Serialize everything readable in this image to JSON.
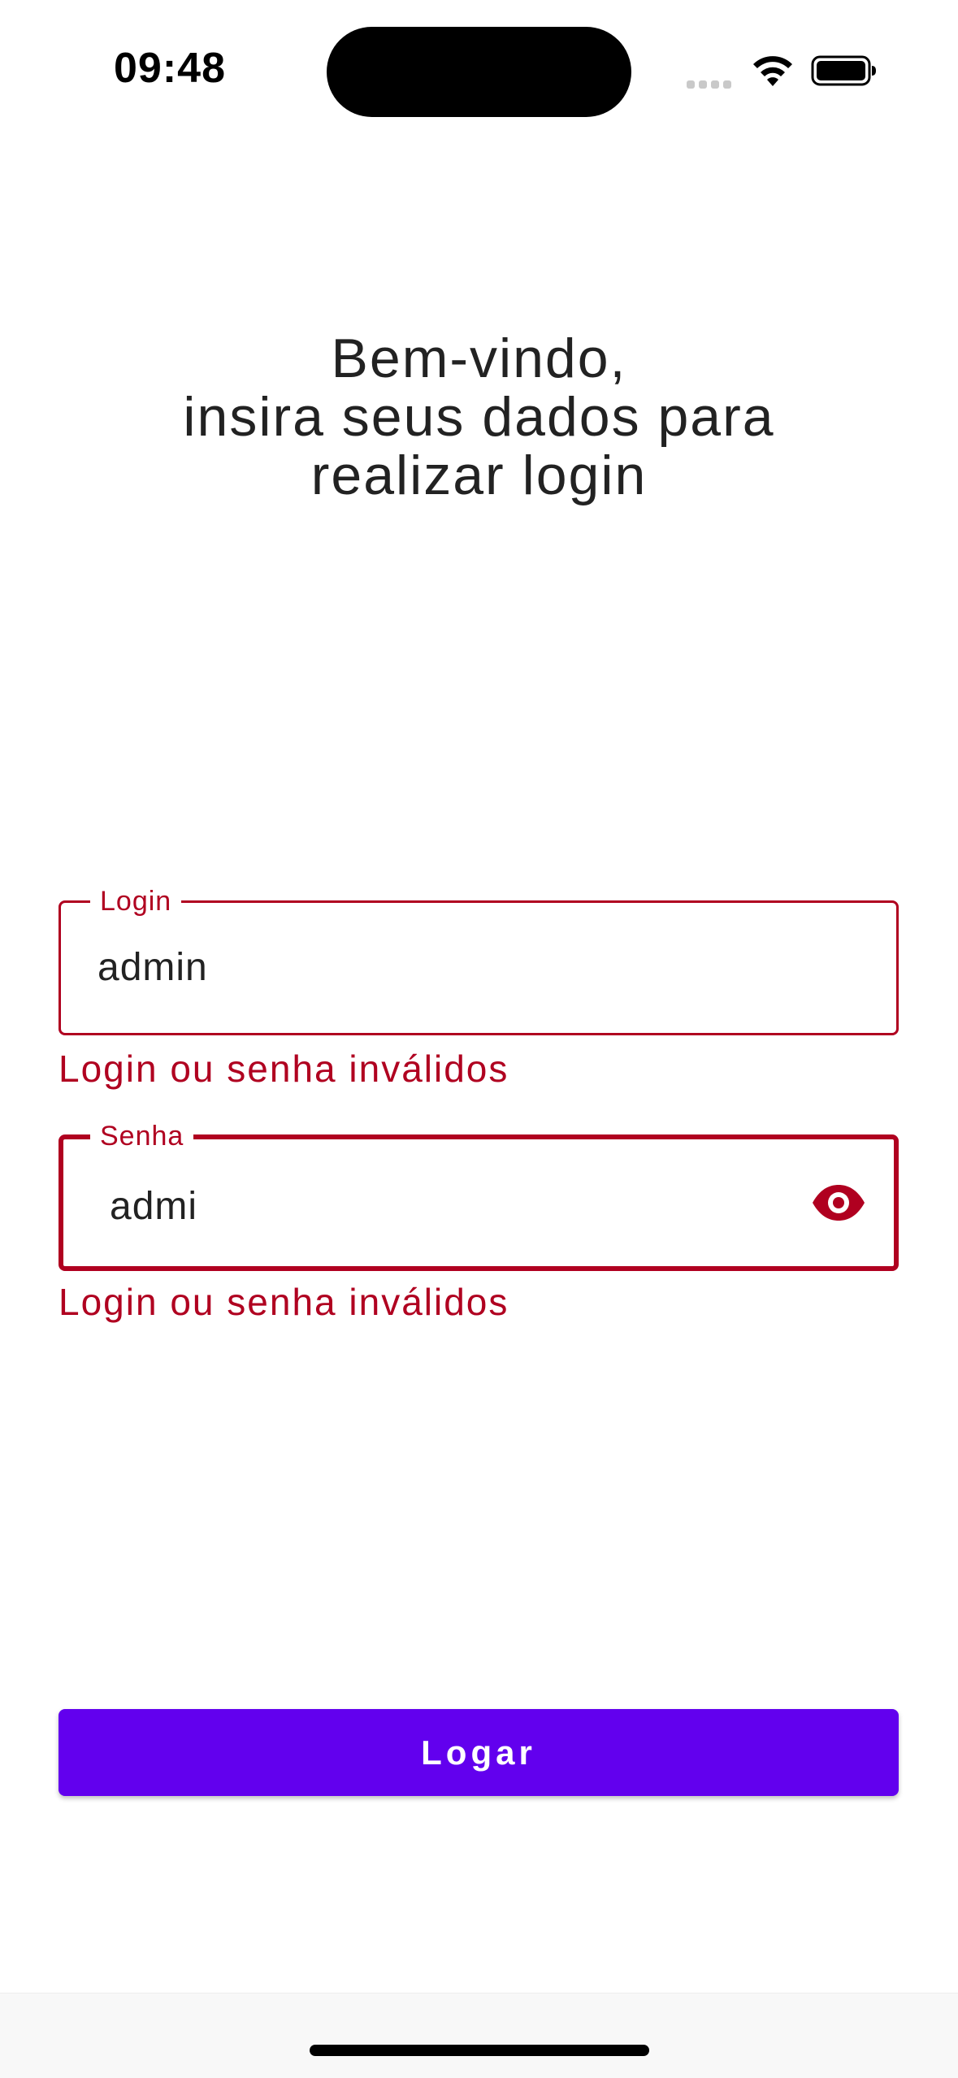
{
  "status_bar": {
    "time": "09:48",
    "signal_icon": "cellular-signal-icon",
    "wifi_icon": "wifi-icon",
    "battery_icon": "battery-icon"
  },
  "header": {
    "line1": "Bem-vindo,",
    "line2": "insira seus dados para",
    "line3": "realizar login"
  },
  "login_field": {
    "label": "Login",
    "value": "admin",
    "error": "Login ou senha inválidos"
  },
  "password_field": {
    "label": "Senha",
    "value": "admi",
    "error": "Login ou senha inválidos",
    "toggle_icon": "eye-icon"
  },
  "actions": {
    "login_label": "Logar"
  },
  "colors": {
    "error": "#b00020",
    "primary": "#6200ee",
    "text": "#222222",
    "background": "#ffffff"
  }
}
